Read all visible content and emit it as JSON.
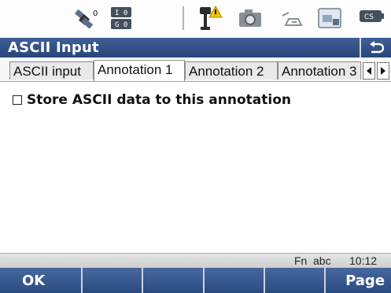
{
  "statusbar": {
    "icons": [
      "satellite-icon",
      "io-status-icon",
      "antenna-warning-icon",
      "camera-icon",
      "instrument-icon",
      "card-icon",
      "battery-icon"
    ],
    "io_labels": [
      "I 0",
      "G 0"
    ],
    "satellite_count": "0",
    "battery_label": "CS"
  },
  "title": "ASCII Input",
  "tabs": [
    "ASCII input",
    "Annotation 1",
    "Annotation 2",
    "Annotation 3"
  ],
  "active_tab": 1,
  "checkbox": {
    "label": "Store ASCII data to this annotation",
    "checked": false
  },
  "infobar": {
    "fn": "Fn",
    "mode": "abc",
    "time": "10:12"
  },
  "softkeys": [
    "OK",
    "",
    "",
    "",
    "",
    "Page"
  ],
  "colors": {
    "title_bar": "#2f4f87",
    "softkey_bar": "#3b5a92"
  }
}
